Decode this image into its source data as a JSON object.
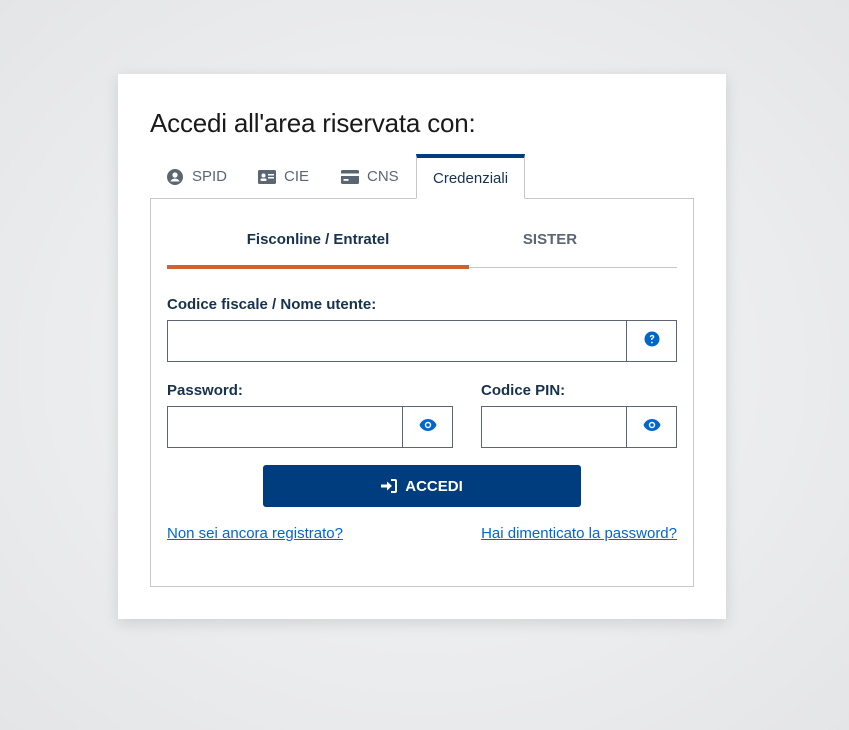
{
  "title": "Accedi all'area riservata con:",
  "tabs": [
    {
      "label": "SPID",
      "icon": "user-circle-icon"
    },
    {
      "label": "CIE",
      "icon": "id-card-icon"
    },
    {
      "label": "CNS",
      "icon": "credit-card-icon"
    },
    {
      "label": "Credenziali",
      "active": true
    }
  ],
  "subtabs": [
    {
      "label": "Fisconline / Entratel",
      "active": true
    },
    {
      "label": "SISTER"
    }
  ],
  "form": {
    "username_label": "Codice fiscale / Nome utente:",
    "username_value": "",
    "password_label": "Password:",
    "password_value": "",
    "pin_label": "Codice PIN:",
    "pin_value": "",
    "submit_label": "ACCEDI"
  },
  "links": {
    "register": "Non sei ancora registrato?",
    "forgot": "Hai dimenticato la password?"
  },
  "colors": {
    "primary": "#003d7e",
    "accent_underline": "#d1622f",
    "link": "#0066cc",
    "icon_blue": "#0066cc"
  }
}
